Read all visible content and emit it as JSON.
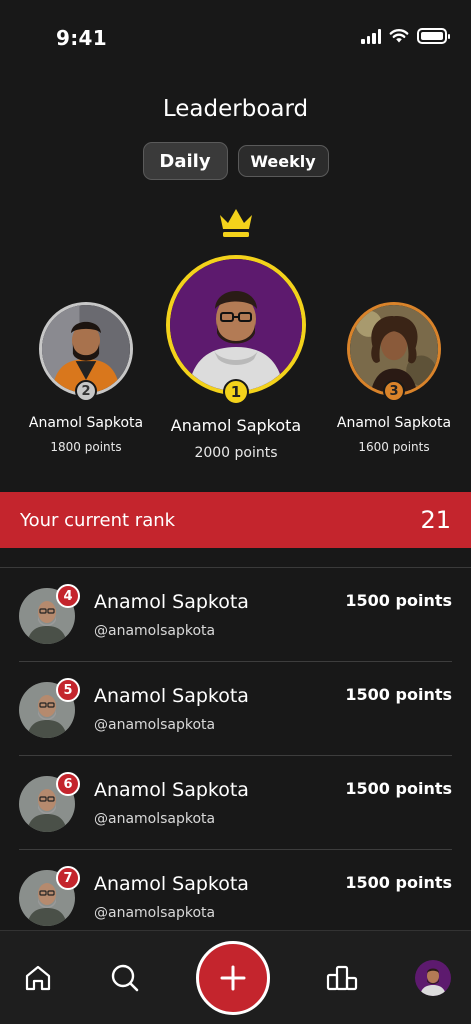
{
  "status_bar": {
    "time": "9:41"
  },
  "title": "Leaderboard",
  "tabs": [
    {
      "label": "Daily",
      "active": true
    },
    {
      "label": "Weekly",
      "active": false
    }
  ],
  "podium": {
    "first": {
      "rank": "1",
      "name": "Anamol Sapkota",
      "points": "2000 points",
      "ring_color": "#f3d21b",
      "bg_color": "#5d1a6e"
    },
    "second": {
      "rank": "2",
      "name": "Anamol Sapkota",
      "points": "1800 points",
      "ring_color": "#c7c7c7"
    },
    "third": {
      "rank": "3",
      "name": "Anamol Sapkota",
      "points": "1600 points",
      "ring_color": "#d9832a"
    }
  },
  "current_rank": {
    "label": "Your current rank",
    "value": "21"
  },
  "list": [
    {
      "rank": "4",
      "name": "Anamol Sapkota",
      "handle": "@anamolsapkota",
      "points": "1500 points"
    },
    {
      "rank": "5",
      "name": "Anamol Sapkota",
      "handle": "@anamolsapkota",
      "points": "1500 points"
    },
    {
      "rank": "6",
      "name": "Anamol Sapkota",
      "handle": "@anamolsapkota",
      "points": "1500 points"
    },
    {
      "rank": "7",
      "name": "Anamol Sapkota",
      "handle": "@anamolsapkota",
      "points": "1500 points"
    }
  ],
  "nav": {
    "items": [
      "home-icon",
      "search-icon",
      "add-icon",
      "leaderboard-icon",
      "profile-avatar"
    ]
  },
  "colors": {
    "accent": "#c4252d",
    "gold": "#f3d21b",
    "silver": "#c7c7c7",
    "bronze": "#d9832a",
    "background": "#181818"
  }
}
